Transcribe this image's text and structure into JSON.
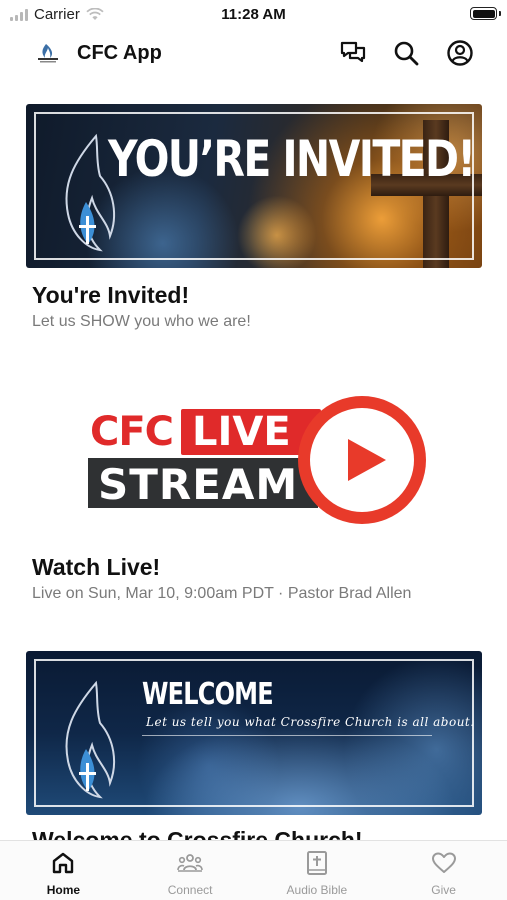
{
  "status_bar": {
    "carrier": "Carrier",
    "time": "11:28 AM"
  },
  "header": {
    "title": "CFC App",
    "icons": [
      "chat-icon",
      "search-icon",
      "account-icon"
    ]
  },
  "feed": [
    {
      "banner_text": "YOU’RE INVITED!",
      "title": "You're Invited!",
      "subtitle": "Let us SHOW you who we are!"
    },
    {
      "logo_text": {
        "cfc": "CFC",
        "live": "LIVE",
        "stream": "STREAM"
      },
      "title": "Watch Live!",
      "subtitle": "Live on Sun, Mar 10, 9:00am PDT · Pastor Brad Allen"
    },
    {
      "banner_text": "WELCOME",
      "banner_subtext": "Let us tell you what Crossfire Church is all about.",
      "title": "Welcome to Crossfire Church!"
    }
  ],
  "tab_bar": {
    "active": "Home",
    "tabs": [
      {
        "label": "Home",
        "icon": "home-icon"
      },
      {
        "label": "Connect",
        "icon": "people-icon"
      },
      {
        "label": "Audio Bible",
        "icon": "bible-icon"
      },
      {
        "label": "Give",
        "icon": "heart-icon"
      }
    ]
  },
  "colors": {
    "live_red": "#e02a2a",
    "stream_dark": "#2f3133",
    "subtitle_gray": "#7a7a7a",
    "tab_inactive": "#9a9a9a"
  }
}
